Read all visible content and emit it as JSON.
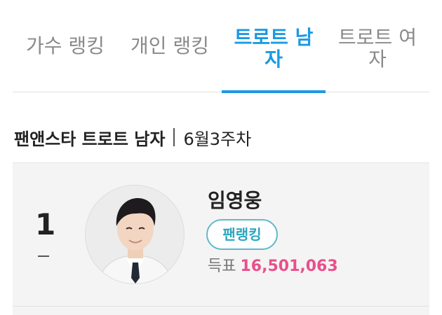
{
  "tabs": [
    {
      "lines": [
        "가수 랭킹"
      ],
      "active": false
    },
    {
      "lines": [
        "개인 랭킹"
      ],
      "active": false
    },
    {
      "lines": [
        "트로트 남",
        "자"
      ],
      "active": true
    },
    {
      "lines": [
        "트로트 여",
        "자"
      ],
      "active": false
    }
  ],
  "colors": {
    "accent": "#1b9ae4",
    "votes": "#ea4f8c",
    "badge": "#2ba7bf",
    "inactive_tab": "#8a8a8a"
  },
  "heading": {
    "title": "팬앤스타 트로트 남자",
    "week": "6월3주차"
  },
  "entry": {
    "rank": "1",
    "rank_change": "–",
    "name": "임영웅",
    "badge": "팬랭킹",
    "votes_label": "득표",
    "votes_count": "16,501,063",
    "avatar_icon": "person-photo-icon"
  }
}
